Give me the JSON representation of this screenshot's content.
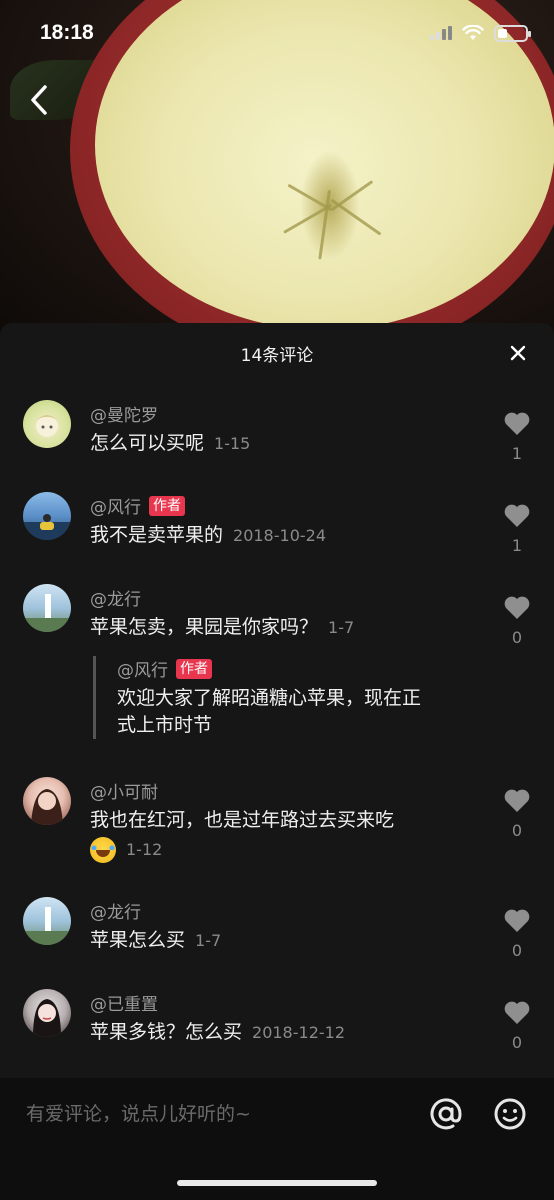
{
  "status_bar": {
    "time": "18:18"
  },
  "icons": {
    "back": "chevron-left-icon",
    "close": "close-icon",
    "like": "heart-icon",
    "at": "at-icon",
    "emoji": "smiley-icon"
  },
  "colors": {
    "accent": "#e8364e",
    "panel_bg": "#161616"
  },
  "panel": {
    "title": "14条评论"
  },
  "comments": [
    {
      "user": "@曼陀罗",
      "text": "怎么可以买呢",
      "time": "1-15",
      "likes": "1"
    },
    {
      "user": "@风行",
      "badge": "作者",
      "text": "我不是卖苹果的",
      "time": "2018-10-24",
      "likes": "1"
    },
    {
      "user": "@龙行",
      "text": "苹果怎卖，果园是你家吗？",
      "time": "1-7",
      "likes": "0",
      "reply": {
        "user": "@风行",
        "badge": "作者",
        "text_line1": "欢迎大家了解昭通糖心苹果，现在正",
        "text_line2": "式上市时节"
      }
    },
    {
      "user": "@小可耐",
      "text": "我也在红河，也是过年路过去买来吃",
      "time": "1-12",
      "likes": "0"
    },
    {
      "user": "@龙行",
      "text": "苹果怎么买",
      "time": "1-7",
      "likes": "0"
    },
    {
      "user": "@已重置",
      "text": "苹果多钱？怎么买",
      "time": "2018-12-12",
      "likes": "0"
    }
  ],
  "input": {
    "placeholder": "有爱评论，说点儿好听的~"
  }
}
